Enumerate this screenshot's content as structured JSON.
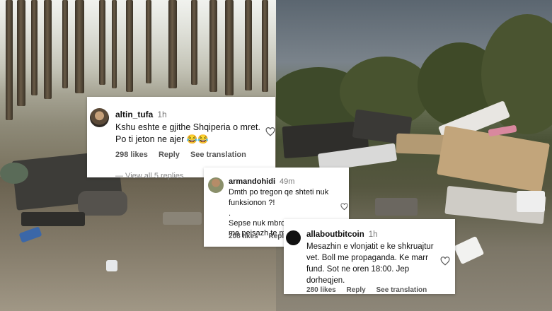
{
  "comments": [
    {
      "username": "altin_tufa",
      "time": "1h",
      "text": "Kshu eshte e gjithe Shqiperia o mret. Po ti jeton ne ajer 😂😂",
      "likes": "298 likes",
      "reply": "Reply",
      "translate": "See translation",
      "view_replies": "View all 5 replies"
    },
    {
      "username": "armandohidi",
      "time": "49m",
      "line1": "Dmth po tregon qe shteti nuk funksionon ?!",
      "line2": ".",
      "line3": "Sepse nuk mbron e pastron nje vend",
      "line4": "me peisazh te mbro",
      "likes": "208 likes",
      "reply": "Reply",
      "translate": "Se"
    },
    {
      "username": "allaboutbitcoin",
      "time": "1h",
      "text": "Mesazhin e vlonjatit e ke shkruajtur vet. Boll me propaganda. Ke marr fund. Sot ne oren 18:00. Jep dorheqjen.",
      "likes": "280 likes",
      "reply": "Reply",
      "translate": "See translation"
    }
  ],
  "icons": {
    "like": "heart-outline-icon"
  }
}
